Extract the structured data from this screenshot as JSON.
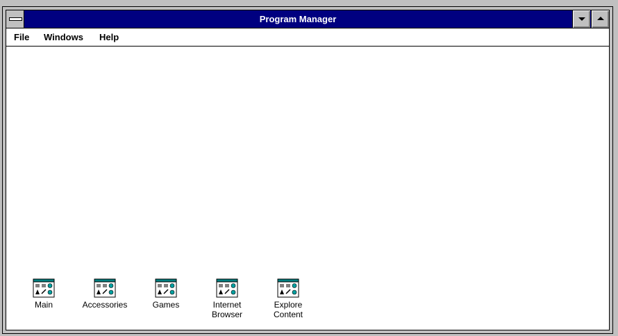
{
  "window": {
    "title": "Program Manager"
  },
  "menu": {
    "items": [
      "File",
      "Windows",
      "Help"
    ]
  },
  "groups": [
    {
      "label": "Main",
      "icon": "program-group-icon"
    },
    {
      "label": "Accessories",
      "icon": "program-group-icon"
    },
    {
      "label": "Games",
      "icon": "program-group-icon"
    },
    {
      "label": "Internet\nBrowser",
      "icon": "program-group-icon"
    },
    {
      "label": "Explore\nContent",
      "icon": "program-group-icon"
    }
  ],
  "colors": {
    "titlebar": "#000080",
    "frame": "#c0c0c0",
    "workspace": "#ffffff"
  }
}
